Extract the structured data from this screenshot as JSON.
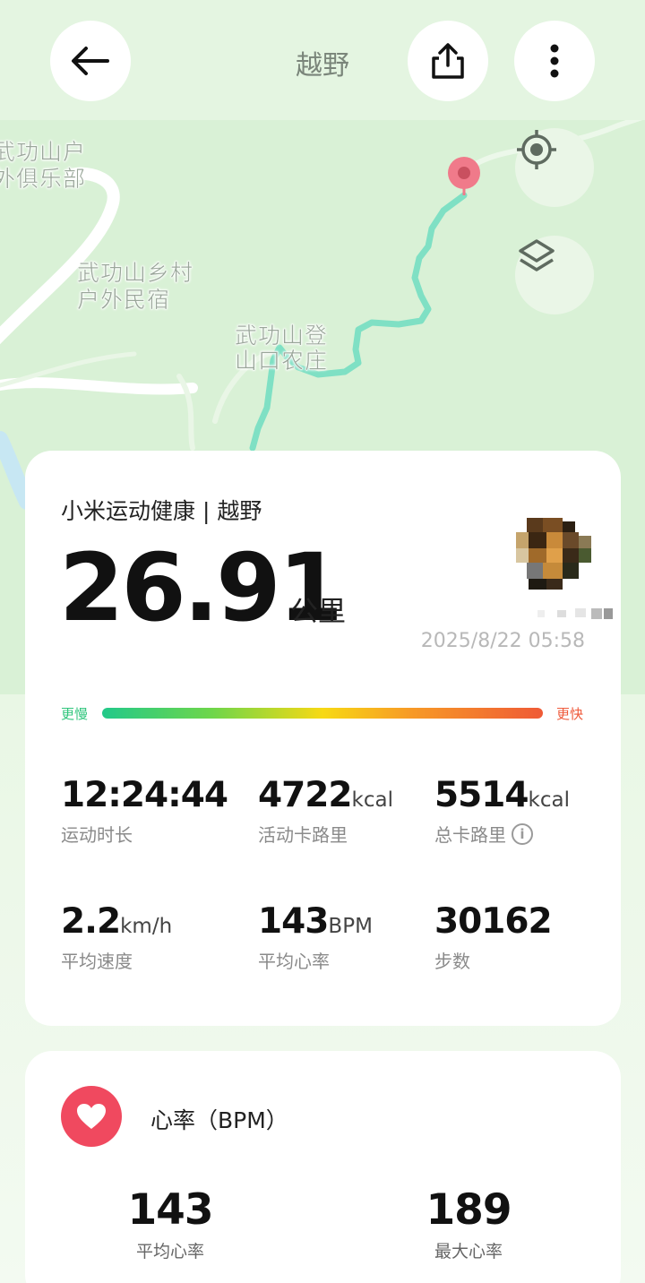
{
  "header": {
    "title": "越野",
    "back_icon": "arrow-left-icon",
    "share_icon": "share-icon",
    "more_icon": "more-vertical-icon"
  },
  "map": {
    "labels": [
      "武功山户",
      "外俱乐部",
      "武功山乡村",
      "户外民宿",
      "武功山登",
      "山口农庄"
    ],
    "locate_icon": "locate-icon",
    "layers_icon": "layers-icon",
    "route_color": "#7fe0c4",
    "end_marker_color": "#f07a8a"
  },
  "summary": {
    "source": "小米运动健康 | 越野",
    "distance": "26.91",
    "distance_unit": "公里",
    "datetime": "2025/8/22 05:58",
    "speed_slow": "更慢",
    "speed_fast": "更快"
  },
  "stats": [
    {
      "value": "12:24:44",
      "unit": "",
      "label": "运动时长"
    },
    {
      "value": "4722",
      "unit": "kcal",
      "label": "活动卡路里"
    },
    {
      "value": "5514",
      "unit": "kcal",
      "label": "总卡路里",
      "info": "i"
    },
    {
      "value": "2.2",
      "unit": "km/h",
      "label": "平均速度"
    },
    {
      "value": "143",
      "unit": "BPM",
      "label": "平均心率"
    },
    {
      "value": "30162",
      "unit": "",
      "label": "步数"
    }
  ],
  "heart_rate": {
    "title": "心率（BPM）",
    "icon": "heart-icon",
    "avg_value": "143",
    "avg_label": "平均心率",
    "max_value": "189",
    "max_label": "最大心率"
  },
  "colors": {
    "accent_heart": "#f0495f",
    "map_bg": "#d9f1d6"
  }
}
